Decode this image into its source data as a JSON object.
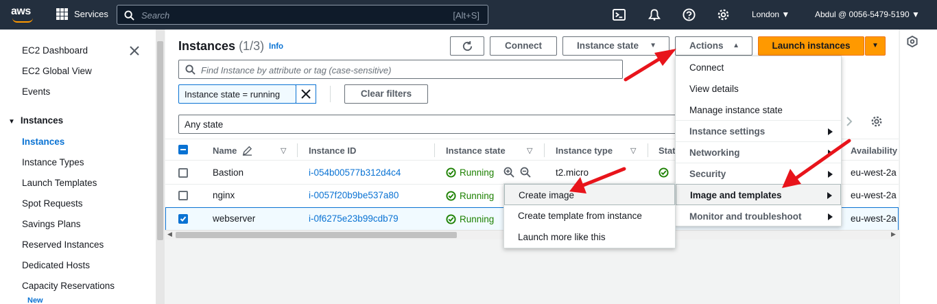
{
  "topbar": {
    "logo": "aws",
    "services_label": "Services",
    "search_placeholder": "Search",
    "search_shortcut": "[Alt+S]",
    "region": "London",
    "account": "Abdul @ 0056-5479-5190"
  },
  "sidebar": {
    "items": [
      {
        "label": "EC2 Dashboard"
      },
      {
        "label": "EC2 Global View"
      },
      {
        "label": "Events"
      }
    ],
    "section_instances": "Instances",
    "sub_items": [
      {
        "label": "Instances"
      },
      {
        "label": "Instance Types"
      },
      {
        "label": "Launch Templates"
      },
      {
        "label": "Spot Requests"
      },
      {
        "label": "Savings Plans"
      },
      {
        "label": "Reserved Instances"
      },
      {
        "label": "Dedicated Hosts"
      },
      {
        "label": "Capacity Reservations"
      }
    ],
    "new_badge": "New"
  },
  "main": {
    "title": "Instances",
    "count": "(1/3)",
    "info": "Info",
    "buttons": {
      "connect": "Connect",
      "instance_state": "Instance state",
      "actions": "Actions",
      "launch": "Launch instances"
    },
    "find_placeholder": "Find Instance by attribute or tag (case-sensitive)",
    "filter_token": "Instance state = running",
    "clear_filters": "Clear filters",
    "state_select": "Any state",
    "columns": [
      "Name",
      "Instance ID",
      "Instance state",
      "Instance type",
      "Stat",
      "Availability"
    ],
    "rows": [
      {
        "name": "Bastion",
        "id": "i-054b00577b312d4c4",
        "state": "Running",
        "type": "t2.micro",
        "az": "eu-west-2a",
        "selected": false
      },
      {
        "name": "nginx",
        "id": "i-0057f20b9be537a80",
        "state": "Running",
        "type": "",
        "az": "eu-west-2a",
        "selected": false
      },
      {
        "name": "webserver",
        "id": "i-0f6275e23b99cdb79",
        "state": "Running",
        "type": "",
        "az": "eu-west-2a",
        "selected": true
      }
    ]
  },
  "actions_menu": {
    "items": [
      {
        "label": "Connect"
      },
      {
        "label": "View details"
      },
      {
        "label": "Manage instance state"
      },
      {
        "label": "Instance settings"
      },
      {
        "label": "Networking"
      },
      {
        "label": "Security"
      },
      {
        "label": "Image and templates"
      },
      {
        "label": "Monitor and troubleshoot"
      }
    ]
  },
  "submenu": {
    "items": [
      {
        "label": "Create image"
      },
      {
        "label": "Create template from instance"
      },
      {
        "label": "Launch more like this"
      }
    ]
  },
  "colors": {
    "topbar": "#232f3e",
    "accent": "#ff9900",
    "link": "#0972d3",
    "running": "#1d8102",
    "annotation_arrow": "#e8141b"
  }
}
